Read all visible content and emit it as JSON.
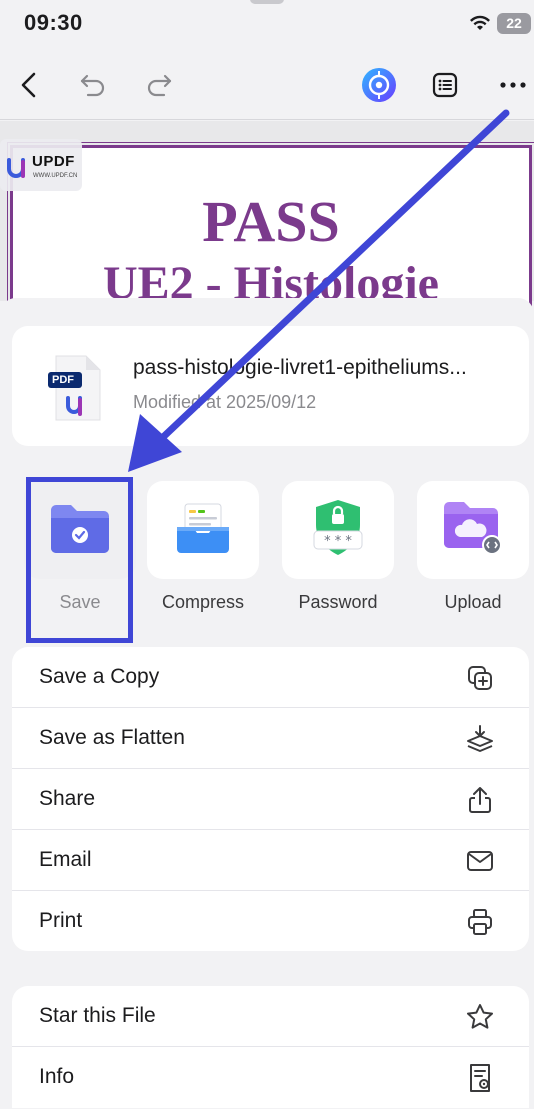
{
  "status_bar": {
    "time": "09:30",
    "battery": "22"
  },
  "document_preview": {
    "title_line1": "PASS",
    "title_line2": "UE2 - Histologie",
    "watermark_brand": "UPDF",
    "watermark_site": "WWW.UPDF.CN"
  },
  "file": {
    "badge": "PDF",
    "name": "pass-histologie-livret1-epitheliums...",
    "meta": "Modified at 2025/09/12"
  },
  "actions": [
    {
      "label": "Save",
      "icon": "folder-check-icon"
    },
    {
      "label": "Compress",
      "icon": "file-tray-icon"
    },
    {
      "label": "Password",
      "icon": "shield-lock-icon"
    },
    {
      "label": "Upload",
      "icon": "cloud-folder-icon"
    }
  ],
  "menu_primary": [
    {
      "label": "Save a Copy",
      "icon": "copy-plus-icon"
    },
    {
      "label": "Save as Flatten",
      "icon": "layers-download-icon"
    },
    {
      "label": "Share",
      "icon": "share-icon"
    },
    {
      "label": "Email",
      "icon": "mail-icon"
    },
    {
      "label": "Print",
      "icon": "printer-icon"
    }
  ],
  "menu_secondary": [
    {
      "label": "Star this File",
      "icon": "star-icon"
    },
    {
      "label": "Info",
      "icon": "file-info-icon"
    }
  ],
  "colors": {
    "accent_purple": "#7b3a8c",
    "annotation_blue": "#3f46d6",
    "background": "#f2f2f4"
  }
}
